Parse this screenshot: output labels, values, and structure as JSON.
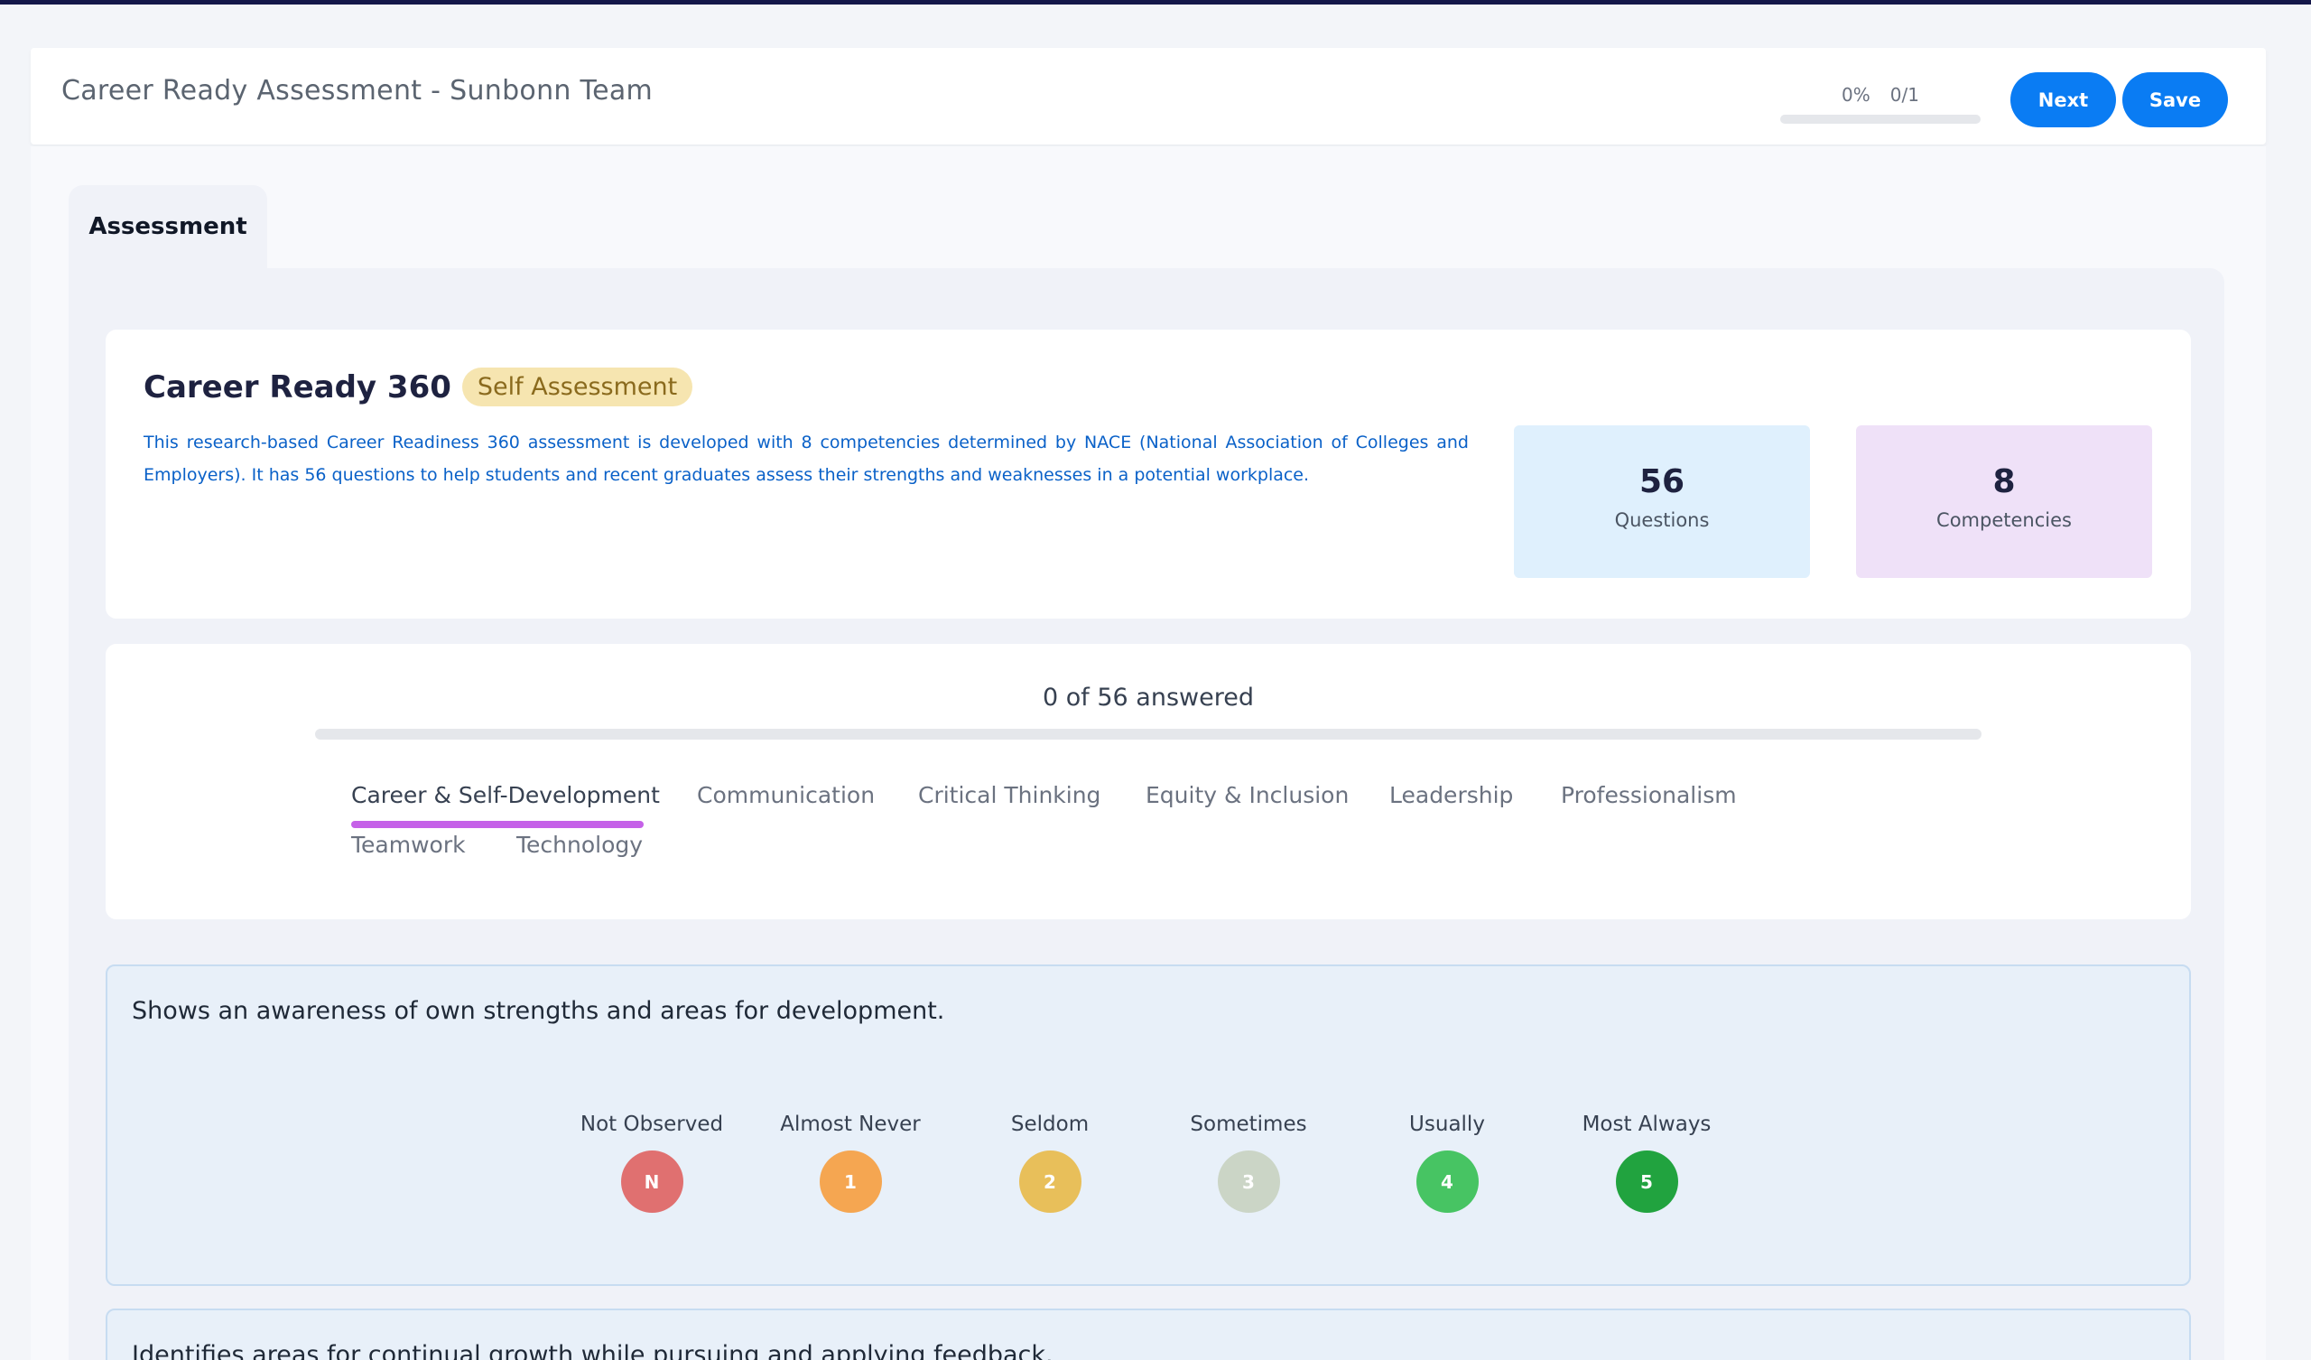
{
  "header": {
    "title": "Career Ready Assessment - Sunbonn Team",
    "progress_percent": "0%",
    "progress_count": "0/1",
    "progress_fraction": 0,
    "next_label": "Next",
    "save_label": "Save"
  },
  "tabs": {
    "assessment_label": "Assessment"
  },
  "info": {
    "title": "Career Ready 360",
    "badge": "Self Assessment",
    "description": "This research-based Career Readiness 360 assessment is developed with 8 competencies determined by NACE (National Association of Colleges and Employers). It has 56 questions to help students and recent graduates assess their strengths and weaknesses in a potential workplace.",
    "questions_count": "56",
    "questions_label": "Questions",
    "competencies_count": "8",
    "competencies_label": "Competencies"
  },
  "progress": {
    "answered_text": "0 of 56 answered",
    "answered_fraction": 0
  },
  "categories": [
    {
      "label": "Career & Self-Development",
      "active": true
    },
    {
      "label": "Communication",
      "active": false
    },
    {
      "label": "Critical Thinking",
      "active": false
    },
    {
      "label": "Equity & Inclusion",
      "active": false
    },
    {
      "label": "Leadership",
      "active": false
    },
    {
      "label": "Professionalism",
      "active": false
    },
    {
      "label": "Teamwork",
      "active": false
    },
    {
      "label": "Technology",
      "active": false
    }
  ],
  "questions": [
    {
      "text": "Shows an awareness of own strengths and areas for development."
    },
    {
      "text": "Identifies areas for continual growth while pursuing and applying feedback."
    }
  ],
  "rating_options": [
    {
      "label": "Not Observed",
      "code": "N",
      "color": "#e07070"
    },
    {
      "label": "Almost Never",
      "code": "1",
      "color": "#f5a651"
    },
    {
      "label": "Seldom",
      "code": "2",
      "color": "#e8bf5a"
    },
    {
      "label": "Sometimes",
      "code": "3",
      "color": "#cbd5c6"
    },
    {
      "label": "Usually",
      "code": "4",
      "color": "#47c463"
    },
    {
      "label": "Most Always",
      "code": "5",
      "color": "#21a33f"
    }
  ]
}
